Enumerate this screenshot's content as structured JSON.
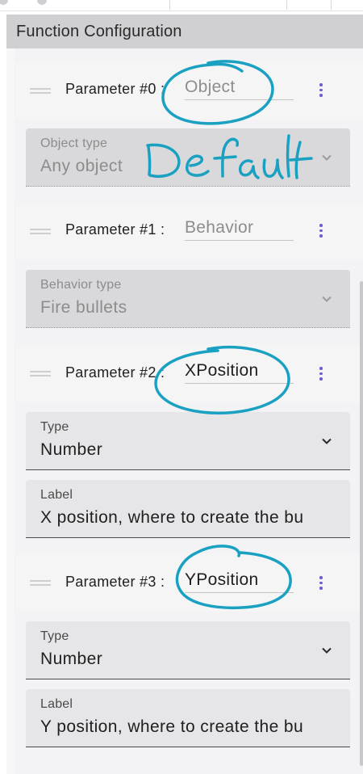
{
  "header": {
    "title": "Function Configuration"
  },
  "parameters": [
    {
      "label": "Parameter #0 :",
      "name": "Object",
      "name_state": "disabled",
      "field": {
        "label": "Object type",
        "value": "Any object",
        "state": "disabled"
      }
    },
    {
      "label": "Parameter #1 :",
      "name": "Behavior",
      "name_state": "disabled",
      "field": {
        "label": "Behavior type",
        "value": "Fire bullets",
        "state": "disabled"
      }
    },
    {
      "label": "Parameter #2 :",
      "name": "XPosition",
      "name_state": "enabled",
      "type_field": {
        "label": "Type",
        "value": "Number"
      },
      "label_field": {
        "label": "Label",
        "value": "X position, where to create the bu"
      }
    },
    {
      "label": "Parameter #3 :",
      "name": "YPosition",
      "name_state": "enabled",
      "type_field": {
        "label": "Type",
        "value": "Number"
      },
      "label_field": {
        "label": "Label",
        "value": "Y position, where to create the bu"
      }
    }
  ],
  "annotation": {
    "handwritten_text": "Default",
    "color": "#1aa1c2"
  },
  "colors": {
    "accent": "#6b5fd1",
    "header_bg": "#d0d0d3",
    "annotation": "#1aa1c2"
  }
}
